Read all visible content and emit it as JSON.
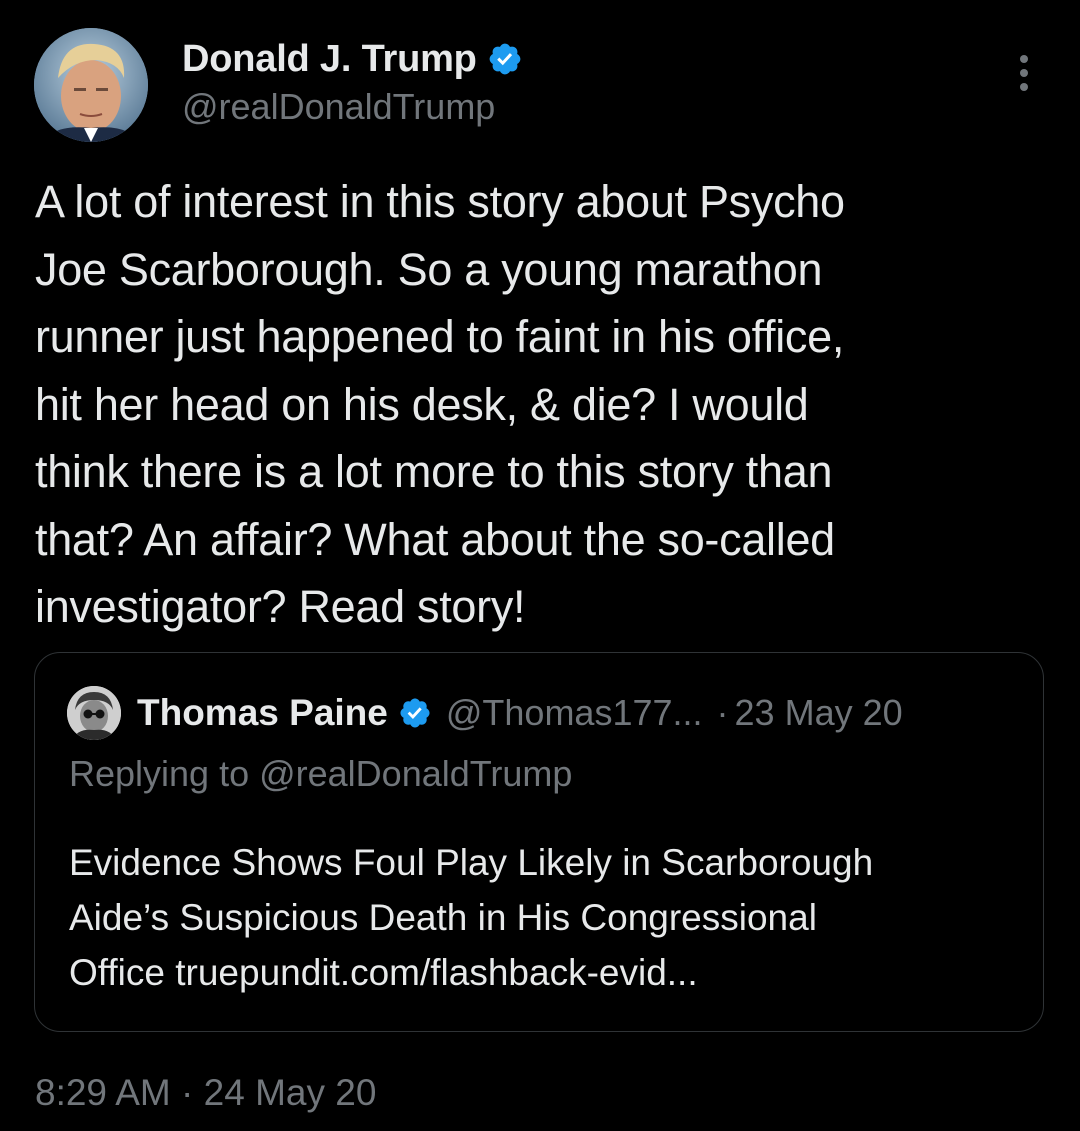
{
  "author": {
    "name": "Donald J. Trump",
    "handle": "@realDonaldTrump",
    "avatar_icon": "profile-photo-icon",
    "verified_icon": "verified-badge-icon"
  },
  "tweet": {
    "text": "A lot of interest in this story about Psycho\nJoe Scarborough. So a young marathon\nrunner just happened to faint in his office,\nhit her head on his desk, & die? I would\nthink there is a lot more to this story than\nthat? An affair? What about the so-called\ninvestigator? Read story!"
  },
  "quoted_tweet": {
    "name": "Thomas Paine",
    "handle": "@Thomas177...",
    "separator": "·",
    "date": "23 May 20",
    "replying_to": "Replying to @realDonaldTrump",
    "text": "Evidence Shows Foul Play Likely in Scarborough\nAide’s Suspicious Death in His Congressional\nOffice truepundit.com/flashback-evid..."
  },
  "footer": {
    "timestamp": "8:29 AM · 24 May 20"
  },
  "colors": {
    "background": "#000000",
    "primary_text": "#e7e9ea",
    "secondary_text": "#71767b",
    "border": "#2f3336",
    "verified_blue": "#1d9bf0"
  }
}
